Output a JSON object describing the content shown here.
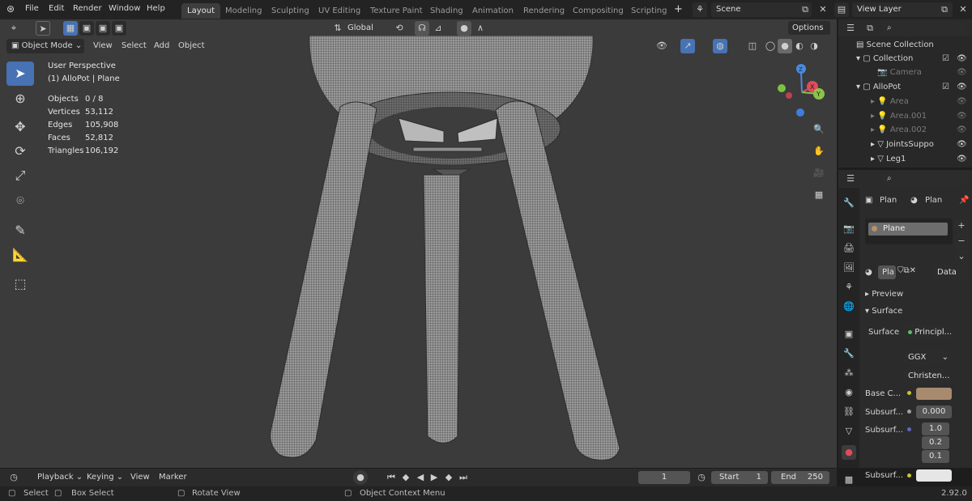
{
  "topbar": {
    "menus": [
      "File",
      "Edit",
      "Render",
      "Window",
      "Help"
    ],
    "workspaces": [
      "Layout",
      "Modeling",
      "Sculpting",
      "UV Editing",
      "Texture Paint",
      "Shading",
      "Animation",
      "Rendering",
      "Compositing",
      "Scripting"
    ],
    "active_workspace": "Layout",
    "add_tab": "+",
    "scene": "Scene",
    "view_layer": "View Layer"
  },
  "viewport_header": {
    "mode": "Object Mode",
    "menus": [
      "View",
      "Select",
      "Add",
      "Object"
    ],
    "orientation": "Global",
    "options": "Options"
  },
  "viewport_info": {
    "view_name": "User Perspective",
    "object_path": "(1) AlloPot | Plane",
    "stats": [
      {
        "label": "Objects",
        "value": "0 / 8"
      },
      {
        "label": "Vertices",
        "value": "53,112"
      },
      {
        "label": "Edges",
        "value": "105,908"
      },
      {
        "label": "Faces",
        "value": "52,812"
      },
      {
        "label": "Triangles",
        "value": "106,192"
      }
    ]
  },
  "gizmo": {
    "x": "X",
    "y": "Y",
    "z": "Z"
  },
  "outliner": {
    "items": [
      {
        "label": "Scene Collection",
        "indent": 0,
        "dim": false
      },
      {
        "label": "Collection",
        "indent": 1,
        "dim": false
      },
      {
        "label": "Camera",
        "indent": 2,
        "dim": true
      },
      {
        "label": "AlloPot",
        "indent": 1,
        "dim": false
      },
      {
        "label": "Area",
        "indent": 2,
        "dim": true
      },
      {
        "label": "Area.001",
        "indent": 2,
        "dim": true
      },
      {
        "label": "Area.002",
        "indent": 2,
        "dim": true
      },
      {
        "label": "JointsSuppo",
        "indent": 2,
        "dim": false
      },
      {
        "label": "Leg1",
        "indent": 2,
        "dim": false
      }
    ]
  },
  "properties": {
    "header_object": "Plan",
    "header_material": "Plan",
    "material_slot": "Plane",
    "material_name": "Pla",
    "data_dd": "Data",
    "preview": "Preview",
    "surface_panel": "Surface",
    "surface_label": "Surface",
    "surface_value": "Principl...",
    "distribution": "GGX",
    "subsurface_method": "Christen...",
    "base_color_label": "Base C...",
    "base_color": "#a88a6e",
    "subsurface_label": "Subsurf...",
    "subsurface_value": "0.000",
    "subsurface_radius_label": "Subsurf...",
    "radius": [
      "1.0",
      "0.2",
      "0.1"
    ],
    "subsurface_color_label": "Subsurf...",
    "subsurface_color": "#e6e6e6"
  },
  "timeline": {
    "menus": [
      "Playback",
      "Keying",
      "View",
      "Marker"
    ],
    "current_frame": "1",
    "start_label": "Start",
    "start": "1",
    "end_label": "End",
    "end": "250"
  },
  "statusbar": {
    "select": "Select",
    "box_select": "Box Select",
    "rotate": "Rotate View",
    "context": "Object Context Menu",
    "version": "2.92.0"
  }
}
